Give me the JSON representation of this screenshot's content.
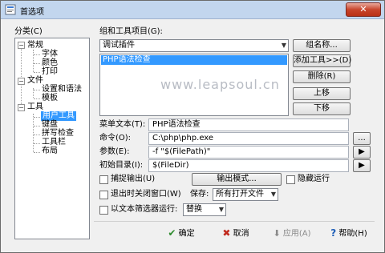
{
  "window": {
    "title": "首选项",
    "close_symbol": "✕"
  },
  "category": {
    "label": "分类(C)",
    "tree": {
      "general": {
        "label": "常规",
        "toggle": "−",
        "children": [
          "字体",
          "颜色",
          "打印"
        ]
      },
      "file": {
        "label": "文件",
        "toggle": "−",
        "children": [
          "设置和语法",
          "模板"
        ]
      },
      "tools": {
        "label": "工具",
        "toggle": "−",
        "children": [
          "用户工具",
          "键盘",
          "拼写检查",
          "工具栏",
          "布局"
        ]
      },
      "selected": "用户工具"
    }
  },
  "group": {
    "label": "组和工具项目(G):",
    "selected": "调试插件",
    "name_button": "组名称...",
    "add_tool_button": "添加工具>>(D)",
    "delete_button": "删除(R)",
    "up_button": "上移",
    "down_button": "下移",
    "items": [
      "PHP语法检查"
    ]
  },
  "watermark": "www.leapsoul.cn",
  "form": {
    "menu_text": {
      "label": "菜单文本(T):",
      "value": "PHP语法检查"
    },
    "command": {
      "label": "命令(O):",
      "value": "C:\\php\\php.exe",
      "browse": "..."
    },
    "params": {
      "label": "参数(E):",
      "value": "-f \"$(FilePath)\""
    },
    "initdir": {
      "label": "初始目录(I):",
      "value": "$(FileDir)"
    }
  },
  "options": {
    "capture_output": "捕捉输出(U)",
    "output_mode": "输出模式...",
    "hide_run": "隐藏运行",
    "close_on_exit": "退出时关闭窗口(W)",
    "save_label": "保存:",
    "save_value": "所有打开文件",
    "run_filter": "以文本筛选器运行:",
    "filter_value": "替换"
  },
  "footer": {
    "ok": "确定",
    "cancel": "取消",
    "apply": "应用(A)",
    "help": "帮助(H)"
  },
  "colors": {
    "selection": "#3399ff",
    "titlebar": "#c2d6ee",
    "close": "#c8452c",
    "ok_check": "#2e8b2e",
    "cancel_x": "#c0281c"
  }
}
